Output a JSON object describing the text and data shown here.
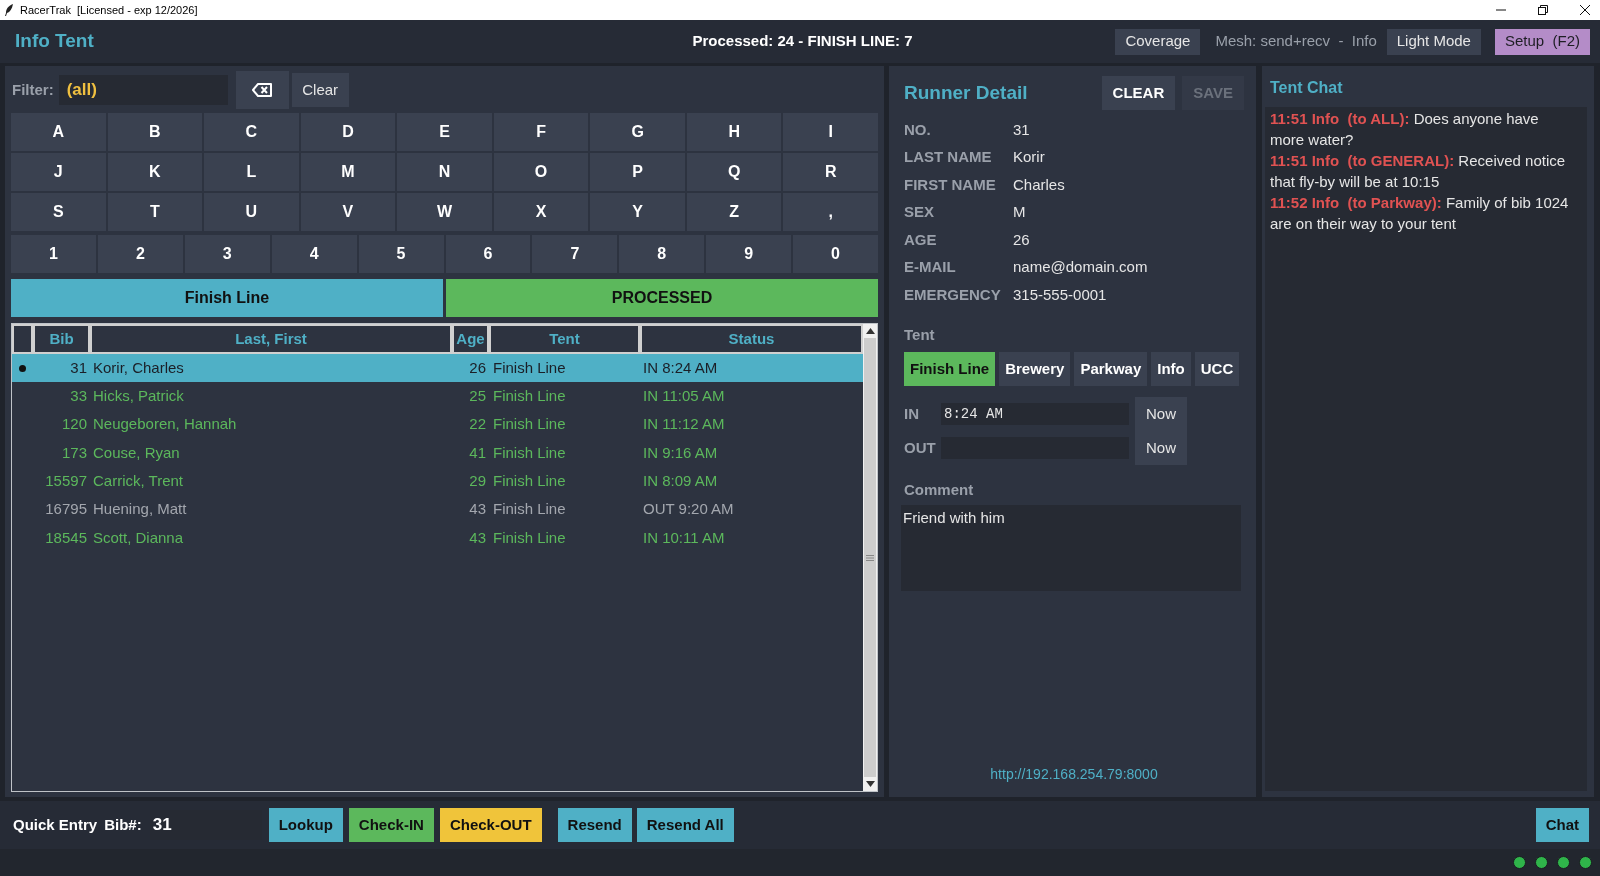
{
  "title_bar": {
    "title": "RacerTrak  [Licensed - exp 12/2026]"
  },
  "header": {
    "title": "Info Tent",
    "summary": "Processed: 24 - FINISH LINE: 7",
    "coverage_button": "Coverage",
    "mesh_status": "Mesh: send+recv  -  Info",
    "theme_button": "Light Mode",
    "setup_button": "Setup  (F2)"
  },
  "filter": {
    "label": "Filter:",
    "value": "(all)",
    "clear_button": "Clear"
  },
  "keypad": {
    "letter_rows": [
      [
        "A",
        "B",
        "C",
        "D",
        "E",
        "F",
        "G",
        "H",
        "I"
      ],
      [
        "J",
        "K",
        "L",
        "M",
        "N",
        "O",
        "P",
        "Q",
        "R"
      ],
      [
        "S",
        "T",
        "U",
        "V",
        "W",
        "X",
        "Y",
        "Z",
        ","
      ]
    ],
    "number_keys": [
      "1",
      "2",
      "3",
      "4",
      "5",
      "6",
      "7",
      "8",
      "9",
      "0"
    ]
  },
  "view_buttons": [
    {
      "label": "Finish Line",
      "color": "#4fb0c6"
    },
    {
      "label": "PROCESSED",
      "color": "#5cb85c"
    }
  ],
  "table": {
    "columns": [
      "Bib",
      "Last, First",
      "Age",
      "Tent",
      "Status"
    ],
    "rows": [
      {
        "bib": "31",
        "name": "Korir, Charles",
        "age": "26",
        "tent": "Finish Line",
        "status": "IN 8:24 AM",
        "selected": true,
        "checked_out": false
      },
      {
        "bib": "33",
        "name": "Hicks, Patrick",
        "age": "25",
        "tent": "Finish Line",
        "status": "IN 11:05 AM",
        "selected": false,
        "checked_out": false
      },
      {
        "bib": "120",
        "name": "Neugeboren, Hannah",
        "age": "22",
        "tent": "Finish Line",
        "status": "IN 11:12 AM",
        "selected": false,
        "checked_out": false
      },
      {
        "bib": "173",
        "name": "Couse, Ryan",
        "age": "41",
        "tent": "Finish Line",
        "status": "IN 9:16 AM",
        "selected": false,
        "checked_out": false
      },
      {
        "bib": "15597",
        "name": "Carrick, Trent",
        "age": "29",
        "tent": "Finish Line",
        "status": "IN 8:09 AM",
        "selected": false,
        "checked_out": false
      },
      {
        "bib": "16795",
        "name": "Huening, Matt",
        "age": "43",
        "tent": "Finish Line",
        "status": "OUT 9:20 AM",
        "selected": false,
        "checked_out": true
      },
      {
        "bib": "18545",
        "name": "Scott, Dianna",
        "age": "43",
        "tent": "Finish Line",
        "status": "IN 10:11 AM",
        "selected": false,
        "checked_out": false
      }
    ]
  },
  "runner_detail": {
    "title": "Runner Detail",
    "clear_button": {
      "label": "CLEAR",
      "disabled": false
    },
    "save_button": {
      "label": "SAVE",
      "disabled": true
    },
    "fields": [
      {
        "label": "NO.",
        "value": "31"
      },
      {
        "label": "LAST NAME",
        "value": "Korir"
      },
      {
        "label": "FIRST NAME",
        "value": "Charles"
      },
      {
        "label": "SEX",
        "value": "M"
      },
      {
        "label": "AGE",
        "value": "26"
      },
      {
        "label": "E-MAIL",
        "value": "name@domain.com"
      },
      {
        "label": "EMERGENCY",
        "value": "315-555-0001"
      }
    ],
    "tent_label": "Tent",
    "tent_options": [
      {
        "label": "Finish Line",
        "selected": true
      },
      {
        "label": "Brewery",
        "selected": false
      },
      {
        "label": "Parkway",
        "selected": false
      },
      {
        "label": "Info",
        "selected": false
      },
      {
        "label": "UCC",
        "selected": false
      }
    ],
    "times": [
      {
        "label": "IN",
        "value": "8:24 AM",
        "button": "Now"
      },
      {
        "label": "OUT",
        "button": "Now"
      }
    ],
    "comment": {
      "label": "Comment",
      "value": "Friend with him"
    },
    "server_link": "http://192.168.254.79:8000"
  },
  "chat": {
    "title": "Tent Chat",
    "messages": [
      {
        "header": "11:51 Info  (to ALL):",
        "text": "Does anyone have more water?"
      },
      {
        "header": "11:51 Info  (to GENERAL):",
        "text": "Received notice that fly-by will be at 10:15"
      },
      {
        "header": "11:52 Info  (to Parkway):",
        "text": "Family of bib 1024 are on their way to your tent"
      }
    ]
  },
  "quick_entry": {
    "label": "Quick Entry",
    "bib_label": "Bib#:",
    "bib_value": "31",
    "entry_buttons": [
      {
        "label": "Lookup",
        "color": "#4fb0c6"
      },
      {
        "label": "Check-IN",
        "color": "#5cb85c"
      },
      {
        "label": "Check-OUT",
        "color": "#f0c43a"
      }
    ],
    "resend_buttons": [
      {
        "label": "Resend",
        "color": "#4fb0c6"
      },
      {
        "label": "Resend All",
        "color": "#4fb0c6"
      }
    ],
    "chat_button": {
      "label": "Chat",
      "color": "#4fb0c6"
    }
  },
  "status_lights": [
    {
      "on": true
    },
    {
      "on": true
    },
    {
      "on": true
    },
    {
      "on": true
    }
  ]
}
